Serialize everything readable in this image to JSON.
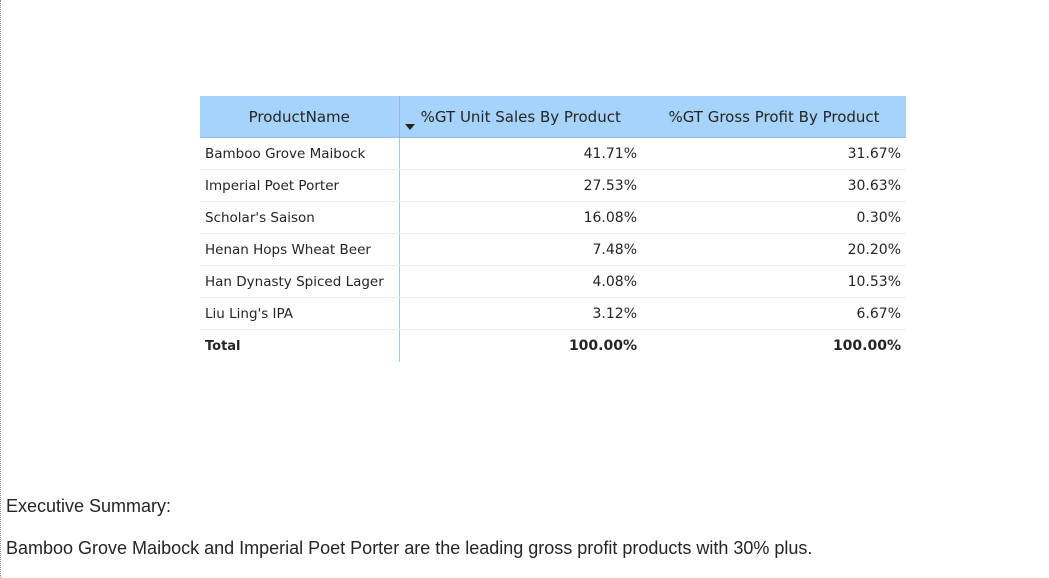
{
  "table": {
    "columns": [
      "ProductName",
      "%GT Unit Sales By Product",
      "%GT Gross Profit By Product"
    ],
    "sort_icon": "caret-down-icon",
    "rows": [
      {
        "name": "Bamboo Grove Maibock",
        "unit_sales": "41.71%",
        "gross_profit": "31.67%"
      },
      {
        "name": "Imperial Poet Porter",
        "unit_sales": "27.53%",
        "gross_profit": "30.63%"
      },
      {
        "name": "Scholar's Saison",
        "unit_sales": "16.08%",
        "gross_profit": "0.30%"
      },
      {
        "name": "Henan Hops Wheat Beer",
        "unit_sales": "7.48%",
        "gross_profit": "20.20%"
      },
      {
        "name": "Han Dynasty Spiced Lager",
        "unit_sales": "4.08%",
        "gross_profit": "10.53%"
      },
      {
        "name": "Liu Ling's IPA",
        "unit_sales": "3.12%",
        "gross_profit": "6.67%"
      }
    ],
    "total": {
      "name": "Total",
      "unit_sales": "100.00%",
      "gross_profit": "100.00%"
    }
  },
  "summary": {
    "title": "Executive Summary:",
    "text": "Bamboo Grove Maibock and Imperial Poet Porter are the leading gross profit products with 30% plus."
  },
  "colors": {
    "header_background": "#a6d3fb",
    "text": "#252423",
    "divider": "#9fcbe8"
  }
}
